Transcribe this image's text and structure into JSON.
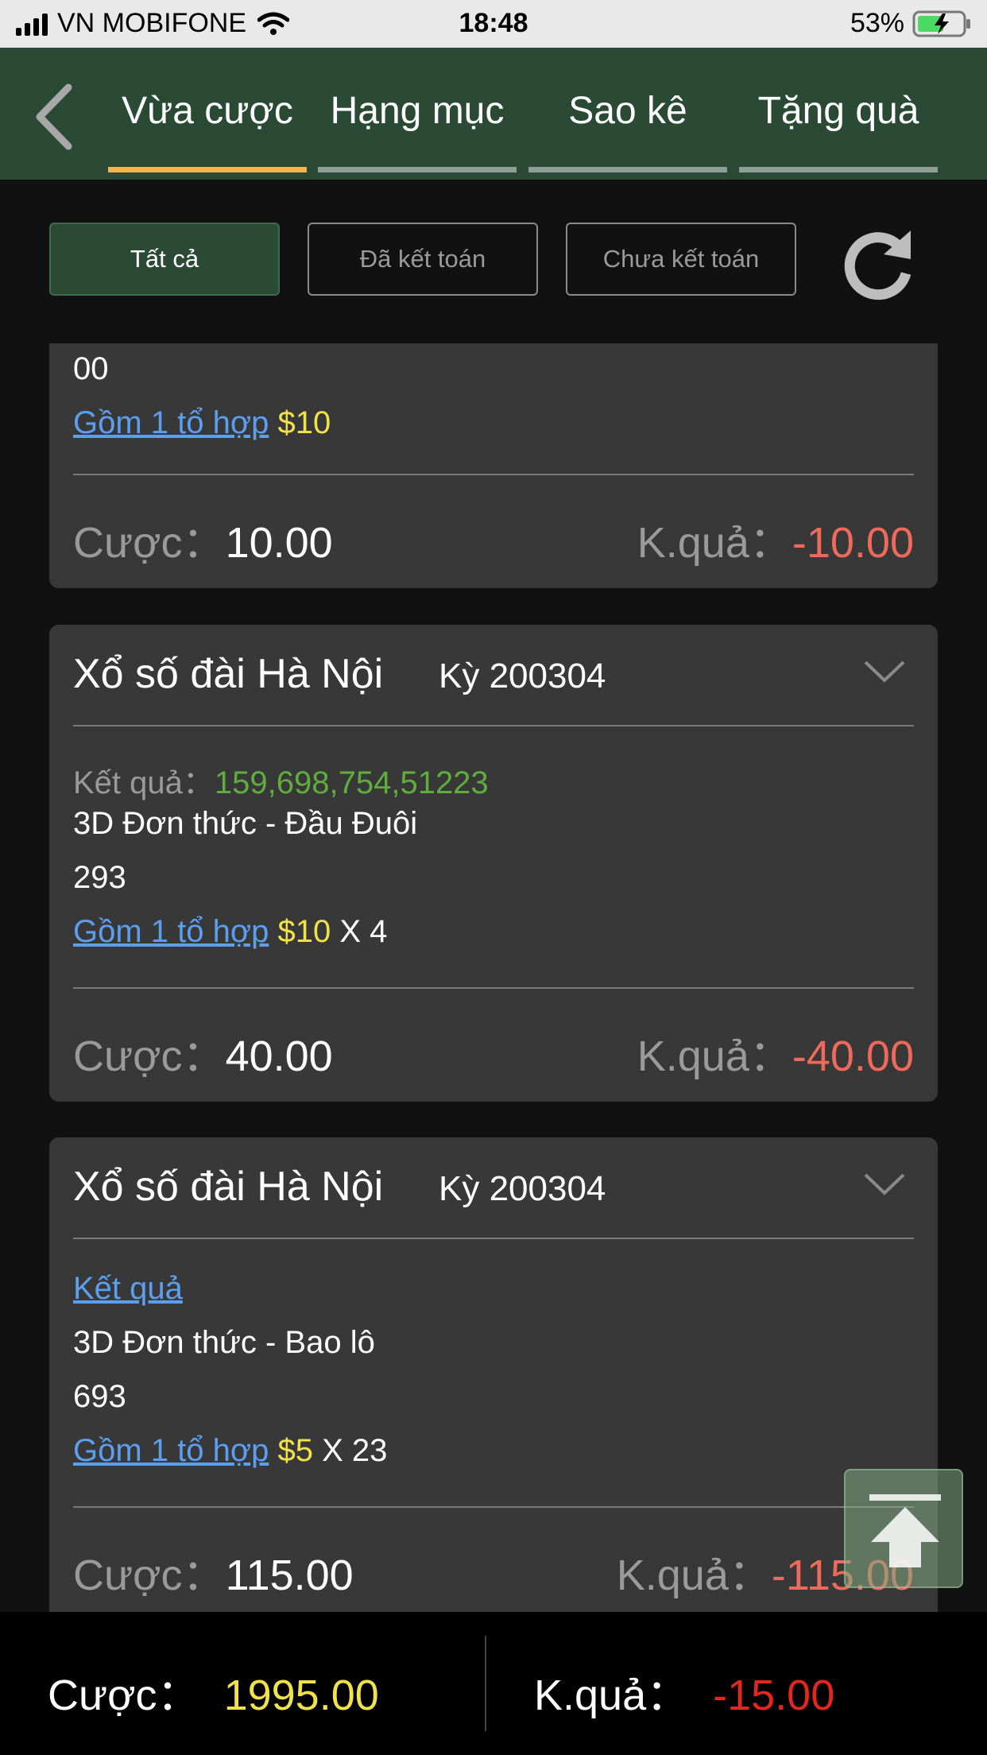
{
  "status_bar": {
    "carrier": "VN MOBIFONE",
    "time": "18:48",
    "battery": "53%"
  },
  "tabs": [
    {
      "label": "Vừa cược",
      "active": true
    },
    {
      "label": "Hạng mục",
      "active": false
    },
    {
      "label": "Sao kê",
      "active": false
    },
    {
      "label": "Tặng quà",
      "active": false
    }
  ],
  "filters": [
    {
      "label": "Tất cả",
      "active": true
    },
    {
      "label": "Đã kết toán",
      "active": false
    },
    {
      "label": "Chưa kết toán",
      "active": false
    }
  ],
  "cards": [
    {
      "number_line": "00",
      "combo_link": "Gồm 1 tổ hợp",
      "combo_amount": "$10",
      "bet_label": "Cược：",
      "bet_value": "10.00",
      "result_label": "K.quả：",
      "result_value": "-10.00"
    },
    {
      "title": "Xổ số đài Hà Nội",
      "period": "Kỳ 200304",
      "result_text_label": "Kết quả：",
      "result_numbers": "159,698,754,51223",
      "bet_type": "3D Đơn thức - Đầu Đuôi",
      "number": "293",
      "combo_link": "Gồm 1 tổ hợp",
      "combo_amount": "$10",
      "combo_multiplier": "X 4",
      "bet_label": "Cược：",
      "bet_value": "40.00",
      "result_label": "K.quả：",
      "result_value": "-40.00"
    },
    {
      "title": "Xổ số đài Hà Nội",
      "period": "Kỳ 200304",
      "result_link": "Kết quả",
      "bet_type": "3D Đơn thức - Bao lô",
      "number": "693",
      "combo_link": "Gồm 1 tổ hợp",
      "combo_amount": "$5",
      "combo_multiplier": "X 23",
      "bet_label": "Cược：",
      "bet_value": "115.00",
      "result_label": "K.quả：",
      "result_value": "-115.00"
    }
  ],
  "summary": {
    "bet_label": "Cược：",
    "bet_total": "1995.00",
    "result_label": "K.quả：",
    "result_total": "-15.00"
  },
  "icons": {
    "back": "chevron-left-icon",
    "refresh": "refresh-icon",
    "expand": "chevron-down-icon",
    "scroll_top": "arrow-up-to-top-icon"
  },
  "colors": {
    "header_bg": "#2b4a36",
    "active_tab_underline": "#f2b54e",
    "card_bg": "#383838",
    "link": "#5c9ff0",
    "amount_yellow": "#f2e24a",
    "loss_red": "#f06a5c",
    "result_green": "#5fae3d"
  }
}
